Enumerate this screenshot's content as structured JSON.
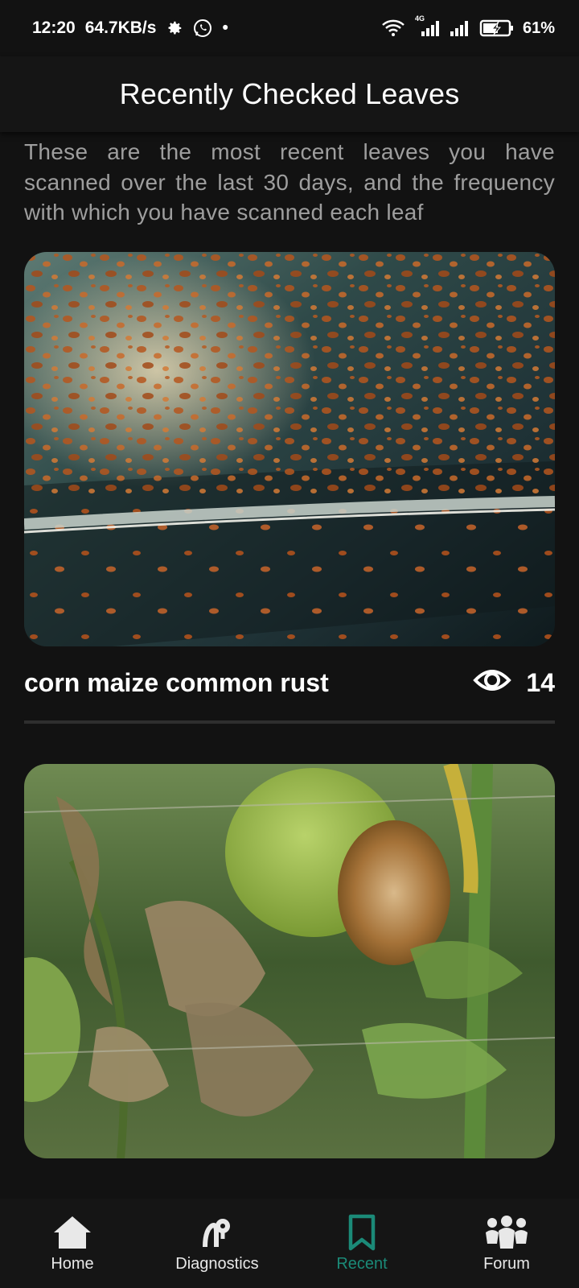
{
  "status_bar": {
    "time": "12:20",
    "network_speed": "64.7KB/s",
    "dot": "•",
    "signal_label": "4G",
    "battery": "61%"
  },
  "app_bar": {
    "title": "Recently Checked Leaves"
  },
  "intro": "These are the most recent leaves you have scanned over the last 30 days, and the frequency with which you have scanned each leaf",
  "cards": [
    {
      "title": "corn maize common rust",
      "views": "14"
    },
    {
      "title": "",
      "views": ""
    }
  ],
  "nav": {
    "items": [
      {
        "label": "Home",
        "icon": "home-icon"
      },
      {
        "label": "Diagnostics",
        "icon": "diagnostics-icon"
      },
      {
        "label": "Recent",
        "icon": "bookmark-icon"
      },
      {
        "label": "Forum",
        "icon": "people-icon"
      }
    ],
    "active": "Recent"
  },
  "colors": {
    "accent": "#1b8a78",
    "background": "#121212",
    "muted_text": "#9e9e9e"
  }
}
